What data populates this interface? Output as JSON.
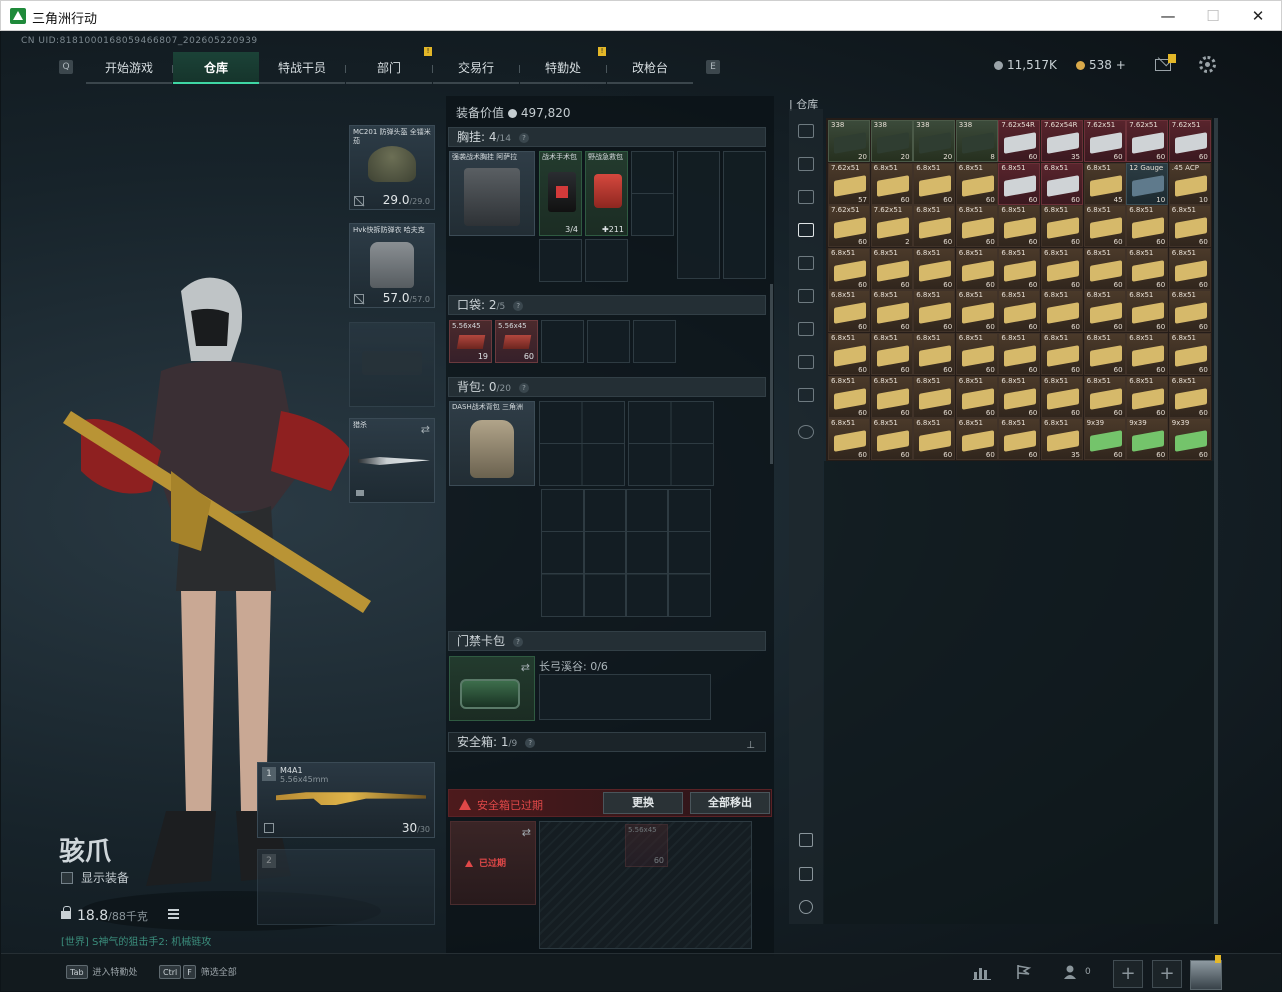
{
  "window": {
    "title": "三角洲行动",
    "controls": [
      "—",
      "☐",
      "✕"
    ]
  },
  "uid": "CN UID:818100016805946680​7_202605220939",
  "nav": {
    "tabs": [
      {
        "label": "开始游戏",
        "active": false,
        "badge": ""
      },
      {
        "label": "仓库",
        "active": true,
        "badge": ""
      },
      {
        "label": "特战干员",
        "active": false,
        "badge": ""
      },
      {
        "label": "部门",
        "active": false,
        "badge": "!"
      },
      {
        "label": "交易行",
        "active": false,
        "badge": ""
      },
      {
        "label": "特勤处",
        "active": false,
        "badge": "!"
      },
      {
        "label": "改枪台",
        "active": false,
        "badge": ""
      }
    ],
    "prev_key": "Q",
    "next_key": "E"
  },
  "currency": {
    "silver": "11,517K",
    "gold": "538",
    "plus": "+"
  },
  "operator": {
    "name": "骇爪",
    "show_equip_label": "显示装备",
    "weight": "18.8",
    "weight_max": "/88千克",
    "chat": "[世界] S神气的狙击手2: 机械链攻"
  },
  "equip": {
    "helmet": {
      "name": "MC201 防弹头盔 全镭米茄",
      "durability": "29.0",
      "max": "/29.0"
    },
    "armor": {
      "name": "Hvk快拆防弹衣 哈夫克",
      "durability": "57.0",
      "max": "/57.0"
    },
    "melee": {
      "name": "猎杀"
    },
    "primary": {
      "slot": "1",
      "name": "M4A1",
      "caliber": "5.56x45mm",
      "ammo": "30",
      "ammo_max": "/30"
    },
    "secondary": {
      "slot": "2"
    }
  },
  "loadout": {
    "value_label": "装备价值",
    "value": "497,820",
    "rig": {
      "label": "胸挂:",
      "count": "4",
      "cap": "/14",
      "name": "强袭战术胸挂 阿萨拉"
    },
    "medkit": {
      "name": "战术手术包",
      "count": "3/4"
    },
    "firstaid": {
      "name": "野战急救包",
      "count": "211"
    },
    "pocket": {
      "label": "口袋:",
      "count": "2",
      "cap": "/5"
    },
    "pocket_items": [
      {
        "name": "5.56x45",
        "count": "19"
      },
      {
        "name": "5.56x45",
        "count": "60"
      }
    ],
    "backpack": {
      "label": "背包:",
      "count": "0",
      "cap": "/20",
      "name": "DASH战术背包 三角洲"
    },
    "keycard": {
      "label": "门禁卡包",
      "sub": "长弓溪谷: 0/6"
    },
    "safebox": {
      "label": "安全箱:",
      "count": "1",
      "cap": "/9",
      "warning": "安全箱已过期",
      "btn_replace": "更换",
      "btn_moveall": "全部移出",
      "expired_label": "已过期",
      "item_name": "5.56x45",
      "item_count": "60"
    }
  },
  "storage": {
    "title": "仓库",
    "rows": [
      [
        {
          "n": "338",
          "c": "20",
          "t": "olive"
        },
        {
          "n": "338",
          "c": "20",
          "t": "olive"
        },
        {
          "n": "338",
          "c": "20",
          "t": "olive"
        },
        {
          "n": "338",
          "c": "8",
          "t": "olive"
        },
        {
          "n": "7.62x54R",
          "c": "60",
          "t": "red"
        },
        {
          "n": "7.62x54R",
          "c": "35",
          "t": "red"
        },
        {
          "n": "7.62x51",
          "c": "60",
          "t": "red"
        },
        {
          "n": "7.62x51",
          "c": "60",
          "t": "red"
        },
        {
          "n": "7.62x51",
          "c": "60",
          "t": "red"
        }
      ],
      [
        {
          "n": "7.62x51",
          "c": "57",
          "t": "tan"
        },
        {
          "n": "6.8x51",
          "c": "60",
          "t": "tan"
        },
        {
          "n": "6.8x51",
          "c": "60",
          "t": "tan"
        },
        {
          "n": "6.8x51",
          "c": "60",
          "t": "tan"
        },
        {
          "n": "6.8x51",
          "c": "60",
          "t": "red"
        },
        {
          "n": "6.8x51",
          "c": "60",
          "t": "red"
        },
        {
          "n": "6.8x51",
          "c": "45",
          "t": "tan"
        },
        {
          "n": "12 Gauge",
          "c": "10",
          "t": "teal"
        },
        {
          "n": ".45 ACP",
          "c": "10",
          "t": "tan"
        }
      ],
      [
        {
          "n": "7.62x51",
          "c": "60",
          "t": "tan"
        },
        {
          "n": "7.62x51",
          "c": "2",
          "t": "tan"
        },
        {
          "n": "6.8x51",
          "c": "60",
          "t": "tan"
        },
        {
          "n": "6.8x51",
          "c": "60",
          "t": "tan"
        },
        {
          "n": "6.8x51",
          "c": "60",
          "t": "tan"
        },
        {
          "n": "6.8x51",
          "c": "60",
          "t": "tan"
        },
        {
          "n": "6.8x51",
          "c": "60",
          "t": "tan"
        },
        {
          "n": "6.8x51",
          "c": "60",
          "t": "tan"
        },
        {
          "n": "6.8x51",
          "c": "60",
          "t": "tan"
        }
      ],
      [
        {
          "n": "6.8x51",
          "c": "60",
          "t": "tan"
        },
        {
          "n": "6.8x51",
          "c": "60",
          "t": "tan"
        },
        {
          "n": "6.8x51",
          "c": "60",
          "t": "tan"
        },
        {
          "n": "6.8x51",
          "c": "60",
          "t": "tan"
        },
        {
          "n": "6.8x51",
          "c": "60",
          "t": "tan"
        },
        {
          "n": "6.8x51",
          "c": "60",
          "t": "tan"
        },
        {
          "n": "6.8x51",
          "c": "60",
          "t": "tan"
        },
        {
          "n": "6.8x51",
          "c": "60",
          "t": "tan"
        },
        {
          "n": "6.8x51",
          "c": "60",
          "t": "tan"
        }
      ],
      [
        {
          "n": "6.8x51",
          "c": "60",
          "t": "tan"
        },
        {
          "n": "6.8x51",
          "c": "60",
          "t": "tan"
        },
        {
          "n": "6.8x51",
          "c": "60",
          "t": "tan"
        },
        {
          "n": "6.8x51",
          "c": "60",
          "t": "tan"
        },
        {
          "n": "6.8x51",
          "c": "60",
          "t": "tan"
        },
        {
          "n": "6.8x51",
          "c": "60",
          "t": "tan"
        },
        {
          "n": "6.8x51",
          "c": "60",
          "t": "tan"
        },
        {
          "n": "6.8x51",
          "c": "60",
          "t": "tan"
        },
        {
          "n": "6.8x51",
          "c": "60",
          "t": "tan"
        }
      ],
      [
        {
          "n": "6.8x51",
          "c": "60",
          "t": "tan"
        },
        {
          "n": "6.8x51",
          "c": "60",
          "t": "tan"
        },
        {
          "n": "6.8x51",
          "c": "60",
          "t": "tan"
        },
        {
          "n": "6.8x51",
          "c": "60",
          "t": "tan"
        },
        {
          "n": "6.8x51",
          "c": "60",
          "t": "tan"
        },
        {
          "n": "6.8x51",
          "c": "60",
          "t": "tan"
        },
        {
          "n": "6.8x51",
          "c": "60",
          "t": "tan"
        },
        {
          "n": "6.8x51",
          "c": "60",
          "t": "tan"
        },
        {
          "n": "6.8x51",
          "c": "60",
          "t": "tan"
        }
      ],
      [
        {
          "n": "6.8x51",
          "c": "60",
          "t": "tan"
        },
        {
          "n": "6.8x51",
          "c": "60",
          "t": "tan"
        },
        {
          "n": "6.8x51",
          "c": "60",
          "t": "tan"
        },
        {
          "n": "6.8x51",
          "c": "60",
          "t": "tan"
        },
        {
          "n": "6.8x51",
          "c": "60",
          "t": "tan"
        },
        {
          "n": "6.8x51",
          "c": "60",
          "t": "tan"
        },
        {
          "n": "6.8x51",
          "c": "60",
          "t": "tan"
        },
        {
          "n": "6.8x51",
          "c": "60",
          "t": "tan"
        },
        {
          "n": "6.8x51",
          "c": "60",
          "t": "tan"
        }
      ],
      [
        {
          "n": "6.8x51",
          "c": "60",
          "t": "tan"
        },
        {
          "n": "6.8x51",
          "c": "60",
          "t": "tan"
        },
        {
          "n": "6.8x51",
          "c": "60",
          "t": "tan"
        },
        {
          "n": "6.8x51",
          "c": "60",
          "t": "tan"
        },
        {
          "n": "6.8x51",
          "c": "60",
          "t": "tan"
        },
        {
          "n": "6.8x51",
          "c": "35",
          "t": "tan"
        },
        {
          "n": "9x39",
          "c": "60",
          "t": "green"
        },
        {
          "n": "9x39",
          "c": "60",
          "t": "green"
        },
        {
          "n": "9x39",
          "c": "60",
          "t": "green"
        }
      ]
    ]
  },
  "bottom": {
    "hint1_key": "Tab",
    "hint1_label": "进入特勤处",
    "hint2_key1": "Ctrl",
    "hint2_key2": "F",
    "hint2_label": "筛选全部",
    "squad_count": "0"
  },
  "colors": {
    "accent": "#3fd6a4",
    "warning": "#e04848",
    "badge": "#e3b728"
  }
}
